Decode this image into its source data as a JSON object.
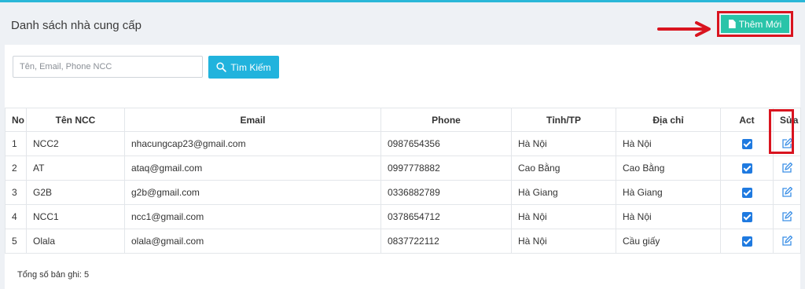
{
  "header": {
    "title": "Danh sách nhà cung cấp",
    "add_label": "Thêm Mới"
  },
  "search": {
    "placeholder": "Tên, Email, Phone NCC",
    "value": "",
    "button_label": "Tìm Kiếm"
  },
  "table": {
    "columns": [
      "No",
      "Tên NCC",
      "Email",
      "Phone",
      "Tỉnh/TP",
      "Địa chỉ",
      "Act",
      "Sửa"
    ],
    "rows": [
      {
        "no": "1",
        "name": "NCC2",
        "email": "nhacungcap23@gmail.com",
        "phone": "0987654356",
        "province": "Hà Nội",
        "address": "Hà Nội",
        "act": true
      },
      {
        "no": "2",
        "name": "AT",
        "email": "ataq@gmail.com",
        "phone": "0997778882",
        "province": "Cao Bằng",
        "address": "Cao Bằng",
        "act": true
      },
      {
        "no": "3",
        "name": "G2B",
        "email": "g2b@gmail.com",
        "phone": "0336882789",
        "province": "Hà Giang",
        "address": "Hà Giang",
        "act": true
      },
      {
        "no": "4",
        "name": "NCC1",
        "email": "ncc1@gmail.com",
        "phone": "0378654712",
        "province": "Hà Nội",
        "address": "Hà Nội",
        "act": true
      },
      {
        "no": "5",
        "name": "Olala",
        "email": "olala@gmail.com",
        "phone": "0837722112",
        "province": "Hà Nội",
        "address": "Cầu giấy",
        "act": true
      }
    ]
  },
  "footer": {
    "total_label": "Tổng số bản ghi: 5"
  },
  "colors": {
    "accent": "#29c4a9",
    "search_button": "#21b3dd",
    "highlight": "#d9141f",
    "checkbox": "#1f7ae0"
  },
  "icons": {
    "add": "document-icon",
    "search": "search-icon",
    "edit": "edit-icon",
    "act": "checkbox-icon"
  }
}
